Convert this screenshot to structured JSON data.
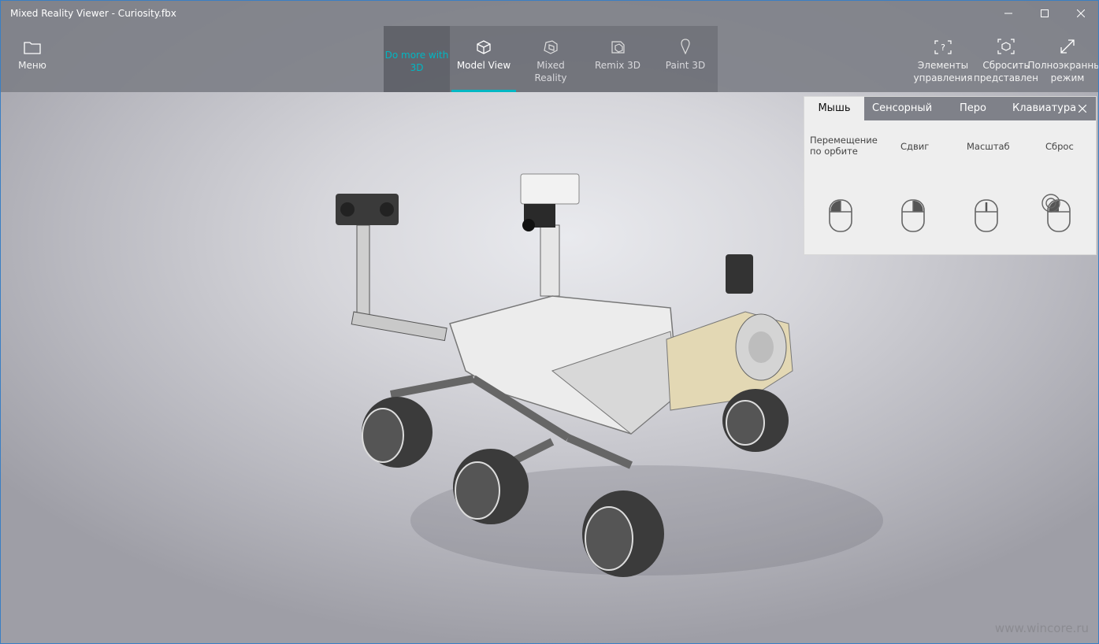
{
  "window": {
    "title": "Mixed Reality Viewer - Curiosity.fbx"
  },
  "toolbar": {
    "menu_label": "Меню",
    "do_more_label": "Do more with 3D",
    "tabs": [
      {
        "label": "Model View",
        "icon": "cube-icon"
      },
      {
        "label": "Mixed Reality",
        "icon": "mixed-reality-icon"
      },
      {
        "label": "Remix 3D",
        "icon": "remix-3d-icon"
      },
      {
        "label": "Paint 3D",
        "icon": "paint-3d-icon"
      }
    ],
    "right_buttons": [
      {
        "label": "Элементы управления",
        "icon": "controls-help-icon"
      },
      {
        "label": "Сбросить представлен",
        "icon": "reset-view-icon"
      },
      {
        "label": "Полноэкранный режим",
        "icon": "fullscreen-icon"
      }
    ],
    "accent": "#00b7c3"
  },
  "controls_panel": {
    "tabs": [
      "Мышь",
      "Сенсорный",
      "Перо",
      "Клавиатура"
    ],
    "columns": [
      "Перемещение по орбите",
      "Сдвиг",
      "Масштаб",
      "Сброс"
    ]
  },
  "watermark": "www.wincore.ru"
}
